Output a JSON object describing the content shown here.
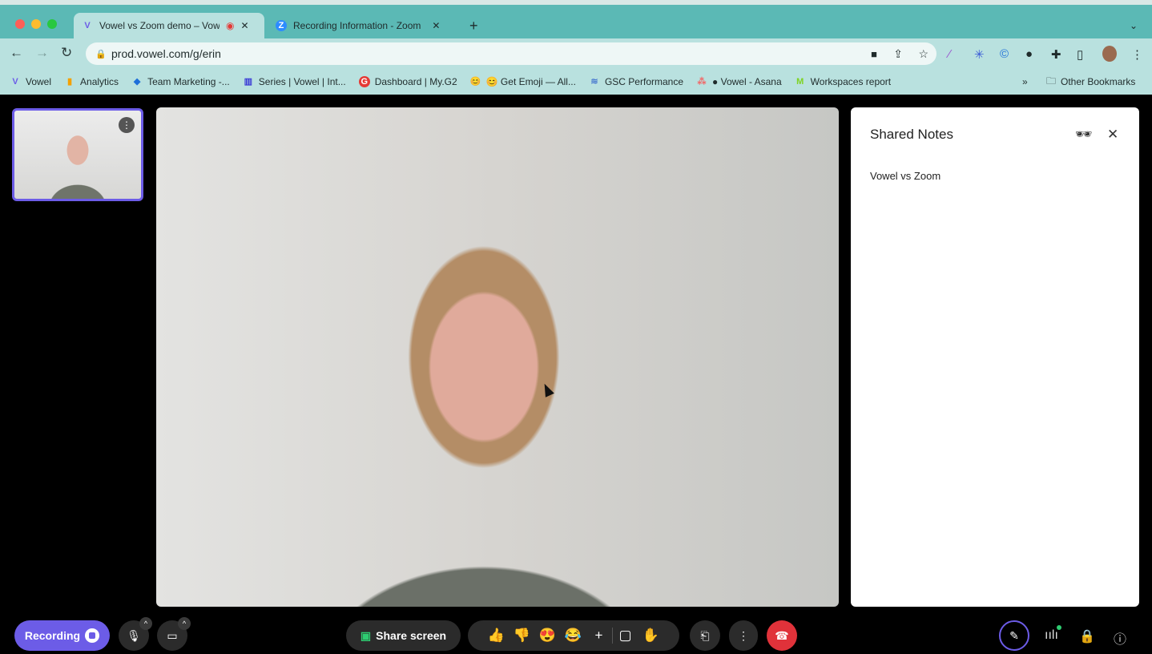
{
  "browser": {
    "tabs": [
      {
        "title": "Vowel vs Zoom demo – Vowel",
        "favicon": "V",
        "recording": true
      },
      {
        "title": "Recording Information - Zoom",
        "favicon": "Z"
      }
    ],
    "new_tab": "+",
    "url": "prod.vowel.com/g/erin",
    "bookmarks": [
      {
        "label": "Vowel",
        "icon": "V",
        "color": "#6c5ce7"
      },
      {
        "label": "Analytics",
        "icon": "▮",
        "color": "#f4a100"
      },
      {
        "label": "Team Marketing -...",
        "icon": "◆",
        "color": "#1e6fd9"
      },
      {
        "label": "Series | Vowel | Int...",
        "icon": "▥",
        "color": "#3b3bd6"
      },
      {
        "label": "Dashboard | My.G2",
        "icon": "G",
        "color": "#e53935"
      },
      {
        "label": "😊 Get Emoji — All...",
        "icon": "😊",
        "color": "transparent"
      },
      {
        "label": "GSC Performance",
        "icon": "≋",
        "color": "transparent"
      },
      {
        "label": "● Vowel - Asana",
        "icon": "⁂",
        "color": "transparent"
      },
      {
        "label": "Workspaces report",
        "icon": "M",
        "color": "#7ed321"
      }
    ],
    "overflow": "»",
    "other_bookmarks": "Other Bookmarks"
  },
  "notes": {
    "title": "Shared Notes",
    "content": "Vowel vs Zoom"
  },
  "controls": {
    "recording_label": "Recording",
    "share_screen": "Share screen",
    "reactions": [
      "👍",
      "👎",
      "😍",
      "😂"
    ]
  },
  "colors": {
    "accent": "#6c5ce7",
    "end_call": "#e0323a",
    "chrome": "#5bb9b5"
  }
}
